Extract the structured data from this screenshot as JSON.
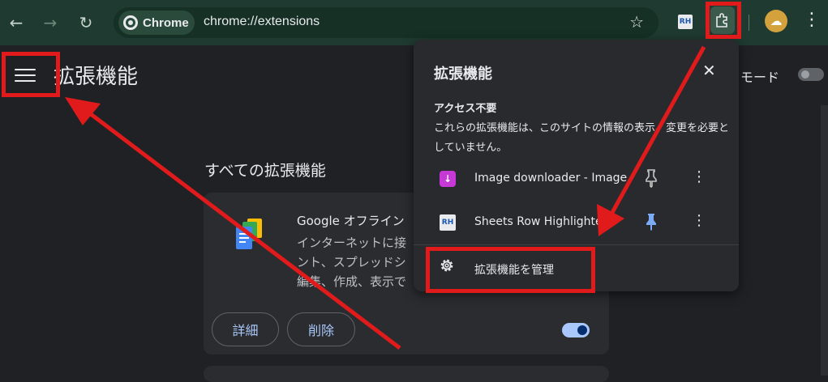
{
  "browser": {
    "chip_label": "Chrome",
    "url": "chrome://extensions",
    "rh_badge": "RH"
  },
  "page": {
    "title": "拡張機能",
    "devmode_label": "モード",
    "section_title": "すべての拡張機能",
    "card": {
      "name": "Google オフライン",
      "desc_lines": [
        "インターネットに接",
        "ント、スプレッドシ",
        "編集、作成、表示で"
      ],
      "details_label": "詳細",
      "remove_label": "削除"
    }
  },
  "popup": {
    "title": "拡張機能",
    "subhead": "アクセス不要",
    "desc": "これらの拡張機能は、このサイトの情報の表示、変更を必要としていません。",
    "items": [
      {
        "name": "Image downloader - Image…",
        "icon": "download-icon",
        "pinned": false
      },
      {
        "name": "Sheets Row Highlighter",
        "icon": "RH",
        "pinned": true
      }
    ],
    "manage_label": "拡張機能を管理"
  },
  "colors": {
    "toolbar": "#1f3a30",
    "accent": "#a8c7fa",
    "annotation": "#e11b1b",
    "pin_active": "#7baaf7"
  }
}
